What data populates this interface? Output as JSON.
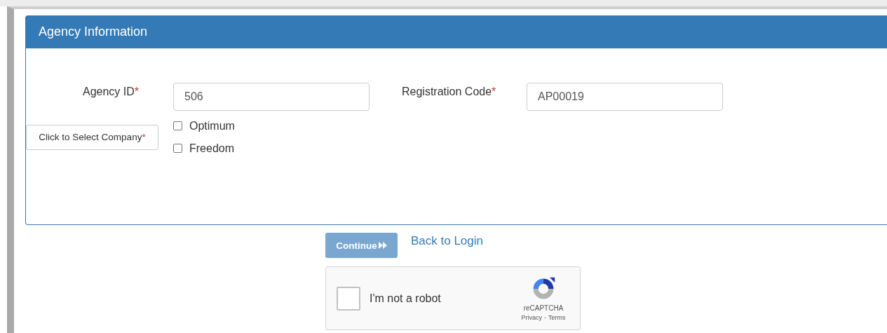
{
  "panel": {
    "title": "Agency Information"
  },
  "fields": [
    {
      "label": "Agency ID",
      "required_mark": "*",
      "value": "506"
    },
    {
      "label": "Registration Code",
      "required_mark": "*",
      "value": "AP00019"
    }
  ],
  "company_button": {
    "label": "Click to Select Company",
    "required_mark": "*"
  },
  "companies": [
    {
      "label": "Optimum",
      "checked": false
    },
    {
      "label": "Freedom",
      "checked": false
    }
  ],
  "actions": {
    "continue": {
      "label": "Continue",
      "disabled": true
    },
    "back_link": "Back to Login"
  },
  "recaptcha": {
    "checked": false,
    "label": "I'm not a robot",
    "brand": "reCAPTCHA",
    "privacy": "Privacy",
    "separator": "-",
    "terms": "Terms"
  }
}
